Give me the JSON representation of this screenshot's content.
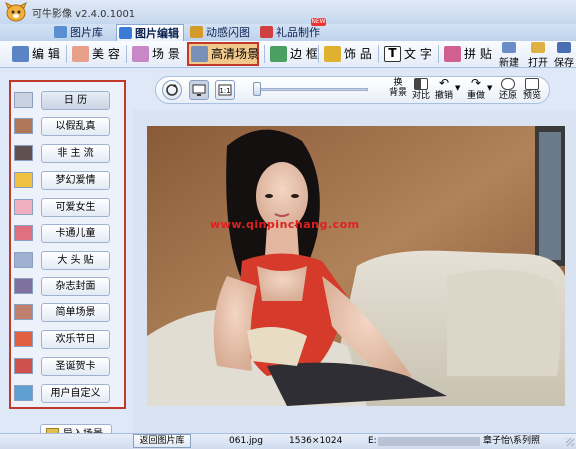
{
  "app": {
    "title": "可牛影像 v2.4.0.1001"
  },
  "tabs": [
    {
      "label": "图片库",
      "icon": "image-library-icon",
      "color": "#5a8fd0"
    },
    {
      "label": "图片编辑",
      "icon": "image-edit-icon",
      "color": "#3a7bd5"
    },
    {
      "label": "动感闪图",
      "icon": "flash-image-icon",
      "color": "#d49a2a"
    },
    {
      "label": "礼品制作",
      "icon": "gift-icon",
      "color": "#d04040",
      "badge": "NEW"
    }
  ],
  "toolbar": {
    "items": [
      {
        "label": "编 辑",
        "icon": "edit-icon"
      },
      {
        "label": "美 容",
        "icon": "beauty-icon"
      },
      {
        "label": "场 景",
        "icon": "scene-icon"
      },
      {
        "label": "高清场景",
        "icon": "hd-scene-icon"
      },
      {
        "label": "边 框",
        "icon": "frame-icon"
      },
      {
        "label": "饰 品",
        "icon": "decoration-icon"
      },
      {
        "label": "文 字",
        "icon": "text-icon"
      },
      {
        "label": "拼 贴",
        "icon": "collage-icon"
      }
    ],
    "new_label": "新建",
    "open_label": "打开",
    "save_label": "保存"
  },
  "sidebar": {
    "items": [
      {
        "label": "日 历"
      },
      {
        "label": "以假乱真"
      },
      {
        "label": "非 主 流"
      },
      {
        "label": "梦幻爱情"
      },
      {
        "label": "可爱女生"
      },
      {
        "label": "卡通儿童"
      },
      {
        "label": "大 头 贴"
      },
      {
        "label": "杂志封面"
      },
      {
        "label": "简单场景"
      },
      {
        "label": "欢乐节日"
      },
      {
        "label": "圣诞贺卡"
      },
      {
        "label": "用户自定义"
      }
    ],
    "import_label": "导入场景"
  },
  "viewtools": {
    "actions": [
      {
        "label": "换背景",
        "line1": "换",
        "line2": "背景"
      },
      {
        "label": "对比",
        "line1": "",
        "line2": "对比"
      },
      {
        "label": "撤销",
        "line1": "",
        "line2": "撤销"
      },
      {
        "label": "重做",
        "line1": "",
        "line2": "重做"
      },
      {
        "label": "还原",
        "line1": "",
        "line2": "还原"
      },
      {
        "label": "预览",
        "line1": "",
        "line2": "预览"
      }
    ]
  },
  "canvas": {
    "watermark": "www.qinpinchang.com"
  },
  "status": {
    "back_label": "返回图片库",
    "filename": "061.jpg",
    "dimensions": "1536×1024",
    "path": "E:",
    "path_tail": "章子怡\\系列照"
  }
}
